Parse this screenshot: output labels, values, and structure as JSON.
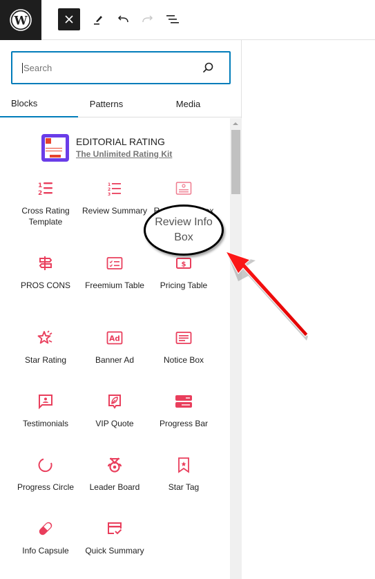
{
  "toolbar": {
    "logo": "wordpress-logo",
    "close_label": "×",
    "buttons": [
      "close",
      "tools",
      "undo",
      "redo",
      "document-overview"
    ]
  },
  "inserter": {
    "search": {
      "placeholder": "Search",
      "value": ""
    },
    "tabs": [
      {
        "label": "Blocks",
        "active": true
      },
      {
        "label": "Patterns",
        "active": false
      },
      {
        "label": "Media",
        "active": false
      }
    ],
    "plugin": {
      "title": "EDITORIAL RATING",
      "subtitle": "The Unlimited Rating Kit"
    },
    "accent_color": "#e93e5c",
    "blocks": [
      {
        "label": "Cross Rating Template",
        "icon": "numbered-list-icon"
      },
      {
        "label": "Review Summary",
        "icon": "ordered-list-icon"
      },
      {
        "label": "Review Info Box",
        "icon": "info-box-icon"
      },
      {
        "label": "PROS CONS",
        "icon": "signpost-icon"
      },
      {
        "label": "Freemium Table",
        "icon": "checklist-table-icon"
      },
      {
        "label": "Pricing Table",
        "icon": "dollar-icon"
      },
      {
        "label": "Star Rating",
        "icon": "star-icon"
      },
      {
        "label": "Banner Ad",
        "icon": "ad-icon"
      },
      {
        "label": "Notice Box",
        "icon": "notice-icon"
      },
      {
        "label": "Testimonials",
        "icon": "testimonial-icon"
      },
      {
        "label": "VIP Quote",
        "icon": "quote-icon"
      },
      {
        "label": "Progress Bar",
        "icon": "progress-bar-icon"
      },
      {
        "label": "Progress Circle",
        "icon": "progress-circle-icon"
      },
      {
        "label": "Leader Board",
        "icon": "medal-icon"
      },
      {
        "label": "Star Tag",
        "icon": "bookmark-star-icon"
      },
      {
        "label": "Info Capsule",
        "icon": "capsule-icon"
      },
      {
        "label": "Quick Summary",
        "icon": "card-check-icon"
      }
    ]
  },
  "annotation": {
    "callout_text": "Review Info Box",
    "line1": "Review Info",
    "line2": "Box",
    "arrow_color": "#ff0000"
  }
}
